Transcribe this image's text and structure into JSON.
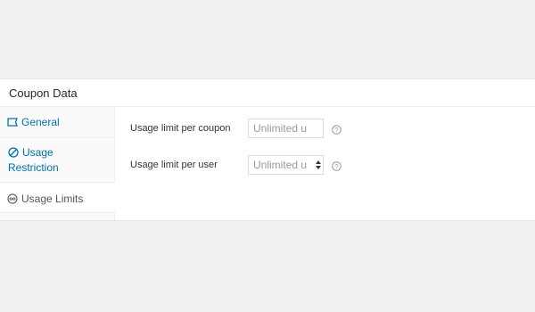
{
  "panel": {
    "title": "Coupon Data"
  },
  "tabs": [
    {
      "label": "General",
      "icon": "ticket-icon"
    },
    {
      "label": "Usage Restriction",
      "label_line1": "Usage",
      "label_line2": "Restriction",
      "icon": "no-entry-icon"
    },
    {
      "label": "Usage Limits",
      "icon": "infinity-icon",
      "active": true
    }
  ],
  "fields": {
    "per_coupon": {
      "label": "Usage limit per coupon",
      "placeholder": "Unlimited u",
      "help_icon": "question-circle-icon"
    },
    "per_user": {
      "label": "Usage limit per user",
      "placeholder": "Unlimited u",
      "help_icon": "question-circle-icon"
    }
  },
  "colors": {
    "link": "#0073aa",
    "active_tab_text": "#555555",
    "background": "#f1f1f1"
  }
}
